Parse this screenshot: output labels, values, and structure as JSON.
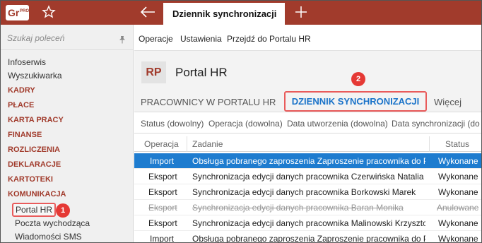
{
  "app": {
    "logo_text": "Gr",
    "logo_sup": "PRO",
    "tab_title": "Dziennik synchronizacji",
    "colors": {
      "brand": "#a13b2c",
      "selection": "#1e7ccf",
      "highlight": "#e95b5b",
      "badge": "#e53935"
    }
  },
  "sidebar": {
    "search_placeholder": "Szukaj poleceń",
    "items": [
      {
        "label": "Infoserwis"
      },
      {
        "label": "Wyszukiwarka"
      },
      {
        "label": "KADRY"
      },
      {
        "label": "PŁACE"
      },
      {
        "label": "KARTA PRACY"
      },
      {
        "label": "FINANSE"
      },
      {
        "label": "ROZLICZENIA"
      },
      {
        "label": "DEKLARACJE"
      },
      {
        "label": "KARTOTEKI"
      },
      {
        "label": "KOMUNIKACJA"
      },
      {
        "label": "Portal HR"
      },
      {
        "label": "Poczta wychodząca"
      },
      {
        "label": "Wiadomości SMS"
      }
    ]
  },
  "menubar": {
    "items": [
      "Operacje",
      "Ustawienia",
      "Przejdź do Portalu HR"
    ]
  },
  "header": {
    "badge": "RP",
    "title": "Portal HR"
  },
  "tabs": {
    "items": [
      "PRACOWNICY W PORTALU HR",
      "DZIENNIK SYNCHRONIZACJI",
      "Więcej"
    ]
  },
  "filters": [
    "Status (dowolny)",
    "Operacja (dowolna)",
    "Data utworzenia (dowolna)",
    "Data synchronizacji (do"
  ],
  "table": {
    "columns": [
      "Operacja",
      "Zadanie",
      "Status"
    ],
    "rows": [
      {
        "op": "Import",
        "task": "Obsługa pobranego zaproszenia Zaproszenie pracownika do P...",
        "status": "Wykonane"
      },
      {
        "op": "Eksport",
        "task": "Synchronizacja edycji danych pracownika Czerwińska Natalia",
        "status": "Wykonane"
      },
      {
        "op": "Eksport",
        "task": "Synchronizacja edycji danych pracownika Borkowski Marek",
        "status": "Wykonane"
      },
      {
        "op": "Eksport",
        "task": "Synchronizacja edycji danych pracownika Baran Monika",
        "status": "Anulowane"
      },
      {
        "op": "Eksport",
        "task": "Synchronizacja edycji danych pracownika Malinowski Krzysztof",
        "status": "Wykonane"
      },
      {
        "op": "Import",
        "task": "Obsługa pobranego zaproszenia Zaproszenie pracownika do P...",
        "status": "Wykonane"
      }
    ]
  },
  "annotations": {
    "badge1": "1",
    "badge2": "2"
  }
}
